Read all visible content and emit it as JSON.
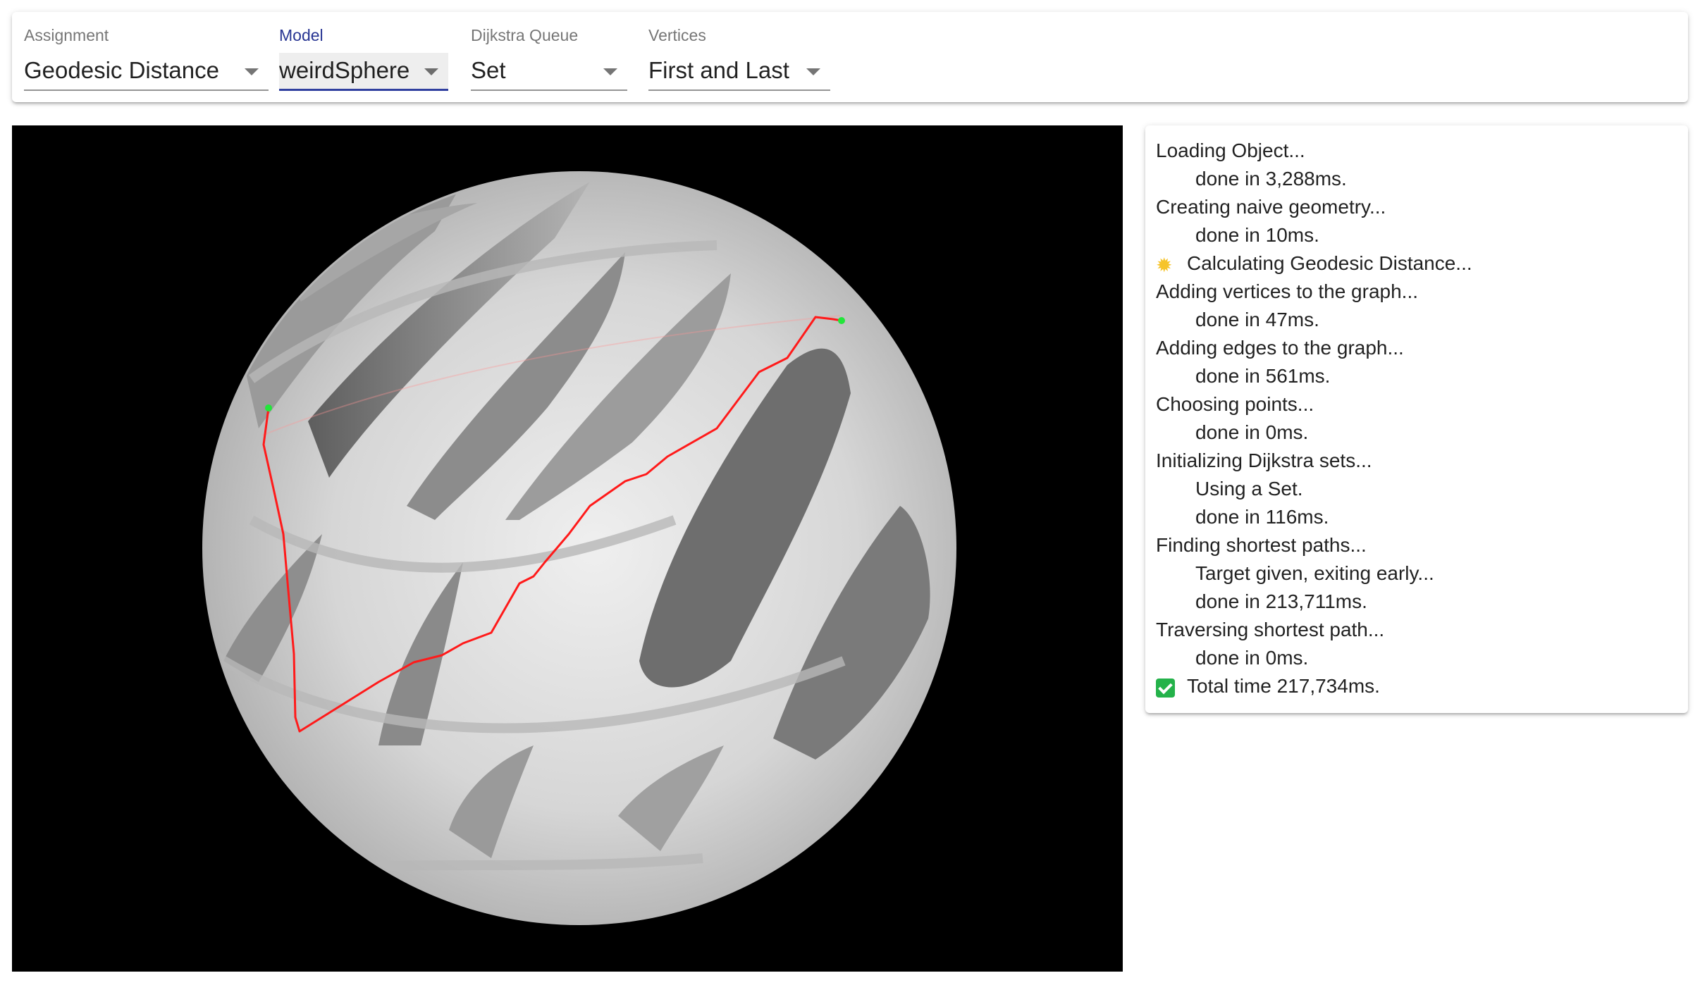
{
  "toolbar": {
    "assignment": {
      "label": "Assignment",
      "value": "Geodesic Distance"
    },
    "model": {
      "label": "Model",
      "value": "weirdSphere"
    },
    "queue": {
      "label": "Dijkstra Queue",
      "value": "Set"
    },
    "vertices": {
      "label": "Vertices",
      "value": "First and Last"
    }
  },
  "viewport": {
    "background": "#000000",
    "model_color": "#d8d8d8",
    "path_color": "#ff1a1a",
    "endpoint_color": "#22e63a"
  },
  "log": [
    {
      "text": "Loading Object...",
      "indent": false,
      "icon": ""
    },
    {
      "text": "done in 3,288ms.",
      "indent": true,
      "icon": ""
    },
    {
      "text": "Creating naive geometry...",
      "indent": false,
      "icon": ""
    },
    {
      "text": "done in 10ms.",
      "indent": true,
      "icon": ""
    },
    {
      "text": "Calculating Geodesic Distance...",
      "indent": false,
      "icon": "sun-icon"
    },
    {
      "text": "Adding vertices to the graph...",
      "indent": false,
      "icon": ""
    },
    {
      "text": "done in 47ms.",
      "indent": true,
      "icon": ""
    },
    {
      "text": "Adding edges to the graph...",
      "indent": false,
      "icon": ""
    },
    {
      "text": "done in 561ms.",
      "indent": true,
      "icon": ""
    },
    {
      "text": "Choosing points...",
      "indent": false,
      "icon": ""
    },
    {
      "text": "done in 0ms.",
      "indent": true,
      "icon": ""
    },
    {
      "text": "Initializing Dijkstra sets...",
      "indent": false,
      "icon": ""
    },
    {
      "text": "Using a Set.",
      "indent": true,
      "icon": ""
    },
    {
      "text": "done in 116ms.",
      "indent": true,
      "icon": ""
    },
    {
      "text": "Finding shortest paths...",
      "indent": false,
      "icon": ""
    },
    {
      "text": "Target given, exiting early...",
      "indent": true,
      "icon": ""
    },
    {
      "text": "done in 213,711ms.",
      "indent": true,
      "icon": ""
    },
    {
      "text": "Traversing shortest path...",
      "indent": false,
      "icon": ""
    },
    {
      "text": "done in 0ms.",
      "indent": true,
      "icon": ""
    },
    {
      "text": "Total time 217,734ms.",
      "indent": false,
      "icon": "check-icon"
    }
  ]
}
